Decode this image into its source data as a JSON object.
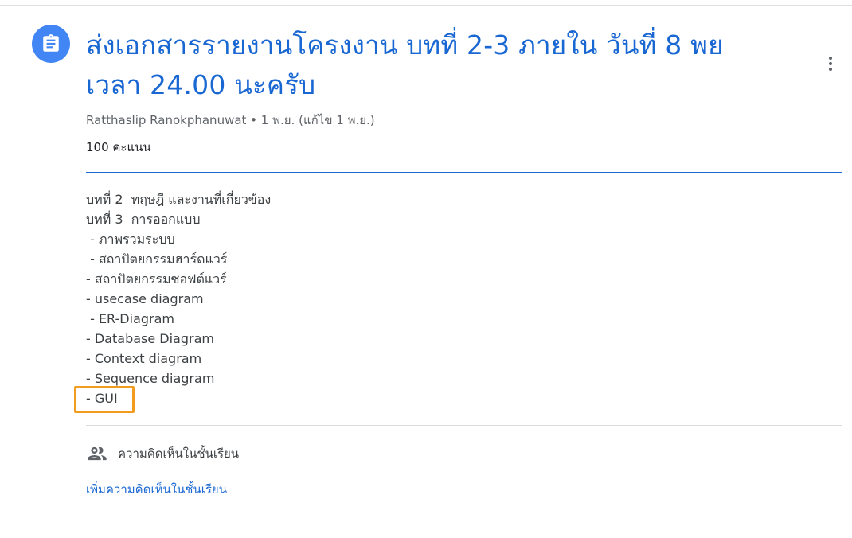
{
  "title": "ส่งเอกสารรายงานโครงงาน บทที่ 2-3  ภายใน วันที่ 8 พย เวลา 24.00 นะครับ",
  "meta": "Ratthaslip Ranokphanuwat • 1 พ.ย. (แก้ไข 1 พ.ย.)",
  "points": "100 คะแนน",
  "description": [
    "บทที่ 2  ทฤษฎี และงานที่เกี่ยวข้อง",
    "บทที่ 3  การออกแบบ",
    " - ภาพรวมระบบ",
    " - สถาปัตยกรรมฮาร์ดแวร์",
    "- สถาปัตยกรรมซอฟต์แวร์",
    "- usecase diagram",
    " - ER-Diagram",
    "- Database Diagram",
    "- Context diagram",
    "- Sequence diagram",
    "- GUI"
  ],
  "comments": {
    "header": "ความคิดเห็นในชั้นเรียน",
    "add_link": "เพิ่มความคิดเห็นในชั้นเรียน"
  },
  "icons": {
    "assignment": "assignment-icon",
    "more": "more-vert-icon",
    "people": "people-icon"
  },
  "colors": {
    "accent": "#1967d2",
    "icon_bg": "#4285f4",
    "highlight": "#f29c1f"
  }
}
